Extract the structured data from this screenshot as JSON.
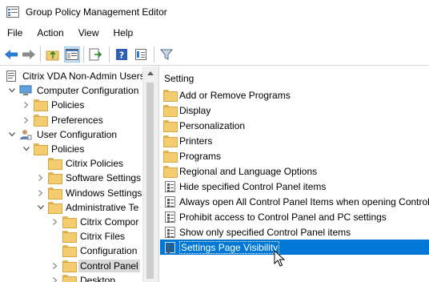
{
  "window": {
    "title": "Group Policy Management Editor"
  },
  "menu": [
    "File",
    "Action",
    "View",
    "Help"
  ],
  "toolbar": {
    "buttons": [
      "back-icon",
      "forward-icon",
      "up-folder-icon",
      "show-hide-tree-icon",
      "export-list-icon",
      "help-icon",
      "properties-icon",
      "filter-icon"
    ]
  },
  "tree": {
    "items": [
      {
        "label": "Citrix VDA Non-Admin Users",
        "level": 0,
        "chevron": "",
        "icon": "policy-doc"
      },
      {
        "label": "Computer Configuration",
        "level": 1,
        "chevron": "expanded",
        "icon": "computer"
      },
      {
        "label": "Policies",
        "level": 2,
        "chevron": "collapsed",
        "icon": "folder"
      },
      {
        "label": "Preferences",
        "level": 2,
        "chevron": "collapsed",
        "icon": "folder"
      },
      {
        "label": "User Configuration",
        "level": 1,
        "chevron": "expanded",
        "icon": "user"
      },
      {
        "label": "Policies",
        "level": 2,
        "chevron": "expanded",
        "icon": "folder"
      },
      {
        "label": "Citrix Policies",
        "level": 3,
        "chevron": "",
        "icon": "folder"
      },
      {
        "label": "Software Settings",
        "level": 3,
        "chevron": "collapsed",
        "icon": "folder"
      },
      {
        "label": "Windows Settings",
        "level": 3,
        "chevron": "collapsed",
        "icon": "folder"
      },
      {
        "label": "Administrative Te",
        "level": 3,
        "chevron": "expanded",
        "icon": "folder"
      },
      {
        "label": "Citrix Compor",
        "level": 4,
        "chevron": "collapsed",
        "icon": "folder"
      },
      {
        "label": "Citrix Files",
        "level": 4,
        "chevron": "",
        "icon": "folder"
      },
      {
        "label": "Configuration",
        "level": 4,
        "chevron": "",
        "icon": "folder"
      },
      {
        "label": "Control Panel",
        "level": 4,
        "chevron": "collapsed",
        "icon": "folder",
        "selected": true
      },
      {
        "label": "Desktop",
        "level": 4,
        "chevron": "collapsed",
        "icon": "folder"
      }
    ]
  },
  "list": {
    "header": "Setting",
    "items": [
      {
        "label": "Add or Remove Programs",
        "icon": "folder"
      },
      {
        "label": "Display",
        "icon": "folder"
      },
      {
        "label": "Personalization",
        "icon": "folder"
      },
      {
        "label": "Printers",
        "icon": "folder"
      },
      {
        "label": "Programs",
        "icon": "folder"
      },
      {
        "label": "Regional and Language Options",
        "icon": "folder"
      },
      {
        "label": "Hide specified Control Panel items",
        "icon": "setting"
      },
      {
        "label": "Always open All Control Panel Items when opening Control",
        "icon": "setting"
      },
      {
        "label": "Prohibit access to Control Panel and PC settings",
        "icon": "setting"
      },
      {
        "label": "Show only specified Control Panel items",
        "icon": "setting"
      },
      {
        "label": "Settings Page Visibility",
        "icon": "setting",
        "selected": true
      }
    ]
  },
  "colors": {
    "selection": "#0078d7",
    "tree_selection": "#d9d9d9",
    "folder": "#f2cc6e"
  }
}
